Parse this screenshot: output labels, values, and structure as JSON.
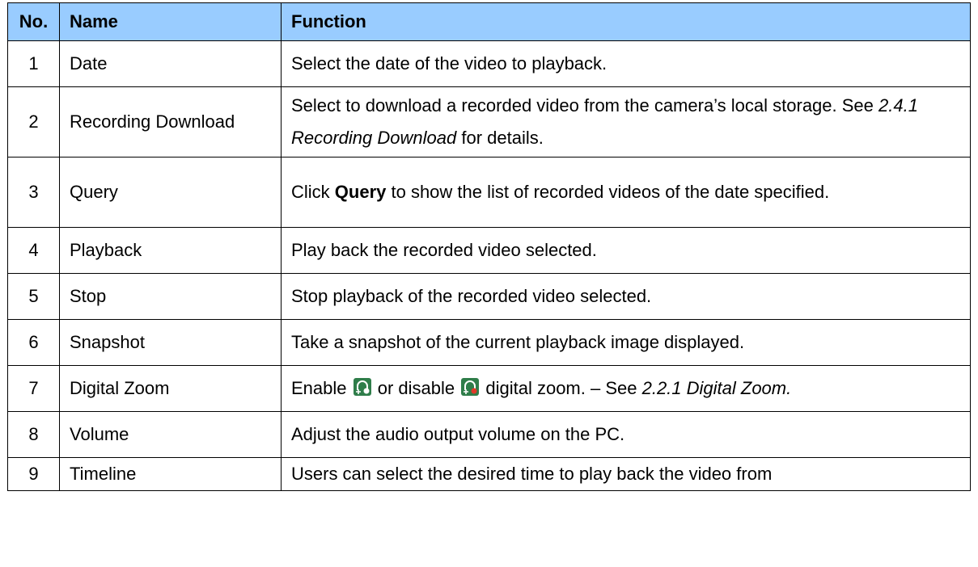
{
  "table": {
    "headers": {
      "no": "No.",
      "name": "Name",
      "function": "Function"
    },
    "rows": [
      {
        "no": "1",
        "name": "Date",
        "function": [
          {
            "t": "Select the date of the video to playback."
          }
        ]
      },
      {
        "no": "2",
        "name": "Recording Download",
        "function": [
          {
            "t": "Select to download a recorded video from the camera’s local storage. See "
          },
          {
            "t": "2.4.1 Recording Download",
            "style": "em"
          },
          {
            "t": " for details."
          }
        ]
      },
      {
        "no": "3",
        "name": "Query",
        "function": [
          {
            "t": "Click "
          },
          {
            "t": "Query",
            "style": "strong"
          },
          {
            "t": " to show the list of recorded videos of the date specified."
          }
        ]
      },
      {
        "no": "4",
        "name": "Playback",
        "function": [
          {
            "t": "Play back the recorded video selected."
          }
        ]
      },
      {
        "no": "5",
        "name": "Stop",
        "function": [
          {
            "t": "Stop playback of the recorded video selected."
          }
        ]
      },
      {
        "no": "6",
        "name": "Snapshot",
        "function": [
          {
            "t": "Take a snapshot of the current playback image displayed."
          }
        ]
      },
      {
        "no": "7",
        "name": "Digital Zoom",
        "function": [
          {
            "t": "Enable "
          },
          {
            "icon": "zoom-enable-icon"
          },
          {
            "t": " or disable "
          },
          {
            "icon": "zoom-disable-icon"
          },
          {
            "t": " digital zoom. – See "
          },
          {
            "t": "2.2.1 Digital Zoom.",
            "style": "em"
          }
        ]
      },
      {
        "no": "8",
        "name": "Volume",
        "function": [
          {
            "t": "Adjust the audio output volume on the PC."
          }
        ]
      },
      {
        "no": "9",
        "name": "Timeline",
        "function": [
          {
            "t": "Users can select the desired time to play back the video from"
          }
        ]
      }
    ]
  },
  "icons": {
    "zoom-enable-icon": {
      "bg": "#2f7d4a",
      "glyph": "#ffffff",
      "badge": "#ffffff"
    },
    "zoom-disable-icon": {
      "bg": "#2f7d4a",
      "glyph": "#ffffff",
      "badge": "#e03a2a"
    }
  }
}
